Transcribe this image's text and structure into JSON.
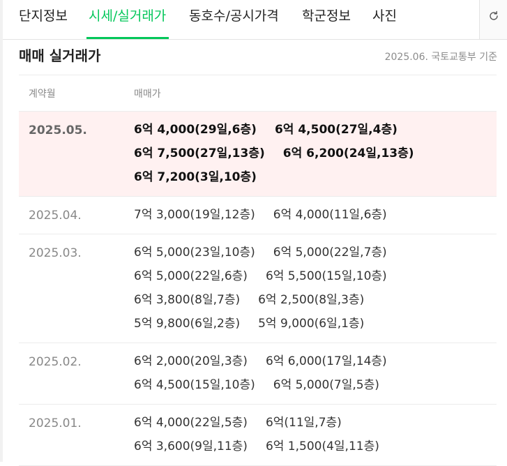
{
  "tabs": [
    {
      "label": "단지정보",
      "active": false
    },
    {
      "label": "시세/실거래가",
      "active": true
    },
    {
      "label": "동호수/공시가격",
      "active": false
    },
    {
      "label": "학군정보",
      "active": false
    },
    {
      "label": "사진",
      "active": false
    }
  ],
  "icons": {
    "refresh": "refresh-icon"
  },
  "colors": {
    "accent": "#03c75a",
    "highlight_bg": "#fff1f1"
  },
  "section": {
    "title": "매매 실거래가",
    "source": "2025.06. 국토교통부 기준"
  },
  "table": {
    "headers": {
      "month": "계약월",
      "price": "매매가"
    },
    "rows": [
      {
        "month": "2025.05.",
        "highlight": true,
        "lines": [
          [
            "6억 4,000(29일,6층)",
            "6억 4,500(27일,4층)"
          ],
          [
            "6억 7,500(27일,13층)",
            "6억 6,200(24일,13층)"
          ],
          [
            "6억 7,200(3일,10층)"
          ]
        ]
      },
      {
        "month": "2025.04.",
        "highlight": false,
        "lines": [
          [
            "7억 3,000(19일,12층)",
            "6억 4,000(11일,6층)"
          ]
        ]
      },
      {
        "month": "2025.03.",
        "highlight": false,
        "lines": [
          [
            "6억 5,000(23일,10층)",
            "6억 5,000(22일,7층)"
          ],
          [
            "6억 5,000(22일,6층)",
            "6억 5,500(15일,10층)"
          ],
          [
            "6억 3,800(8일,7층)",
            "6억 2,500(8일,3층)"
          ],
          [
            "5억 9,800(6일,2층)",
            "5억 9,000(6일,1층)"
          ]
        ]
      },
      {
        "month": "2025.02.",
        "highlight": false,
        "lines": [
          [
            "6억 2,000(20일,3층)",
            "6억 6,000(17일,14층)"
          ],
          [
            "6억 4,500(15일,10층)",
            "6억 5,000(7일,5층)"
          ]
        ]
      },
      {
        "month": "2025.01.",
        "highlight": false,
        "lines": [
          [
            "6억 4,000(22일,5층)",
            "6억(11일,7층)"
          ],
          [
            "6억 3,600(9일,11층)",
            "6억 1,500(4일,11층)"
          ]
        ]
      }
    ]
  }
}
